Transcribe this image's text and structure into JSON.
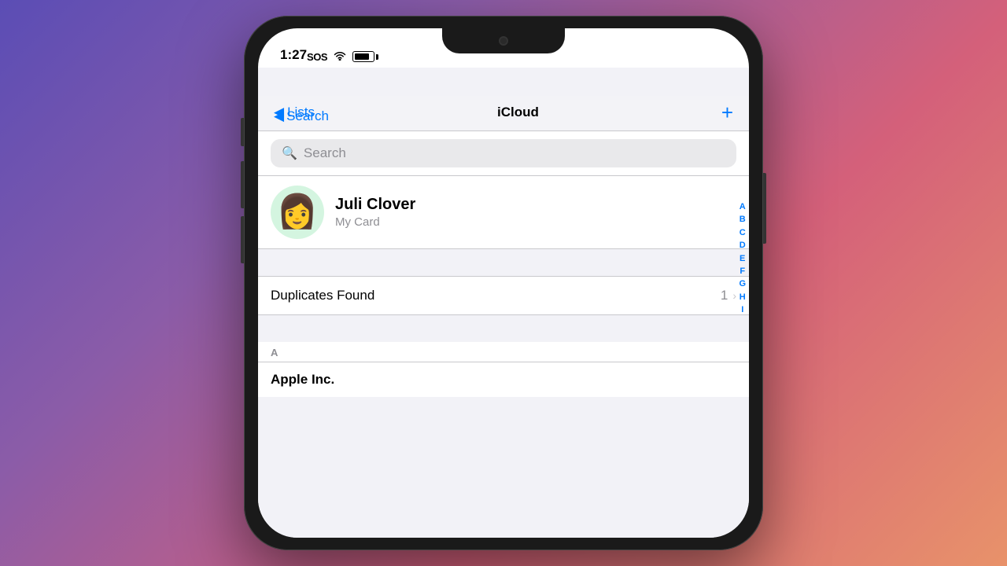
{
  "background": {
    "gradient": "linear-gradient(135deg, #5b4db5 0%, #8b5ca8 30%, #d4607a 65%, #e8926a 100%)"
  },
  "status_bar": {
    "time": "1:27",
    "back_label": "Search",
    "sos": "SOS",
    "wifi_symbol": "📶",
    "battery_percent": 80
  },
  "nav_bar": {
    "back_label": "Lists",
    "title": "iCloud",
    "add_label": "+"
  },
  "search": {
    "placeholder": "Search"
  },
  "my_card": {
    "name": "Juli Clover",
    "subtitle": "My Card",
    "avatar_emoji": "👩"
  },
  "duplicates": {
    "label": "Duplicates Found",
    "count": "1"
  },
  "sections": [
    {
      "letter": "A",
      "contacts": [
        {
          "name": "Apple Inc."
        }
      ]
    }
  ],
  "alphabet_index": [
    "A",
    "B",
    "C",
    "D",
    "E",
    "F",
    "G",
    "H",
    "I"
  ]
}
